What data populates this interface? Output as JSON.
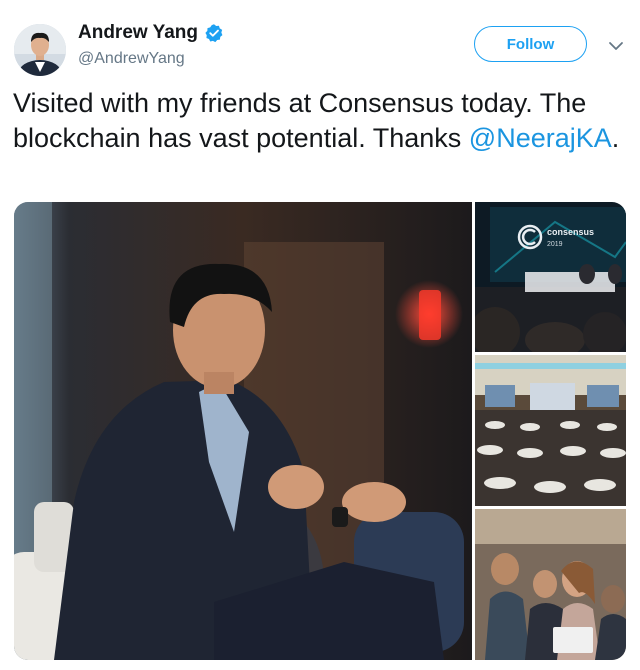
{
  "author": {
    "display_name": "Andrew Yang",
    "handle": "@AndrewYang",
    "verified": true
  },
  "actions": {
    "follow_label": "Follow",
    "more_icon": "chevron-down-icon"
  },
  "tweet": {
    "text_before_mention": "Visited with my friends at Consensus today. The blockchain has vast potential.  Thanks ",
    "mention": "@NeerajKA",
    "text_after_mention": "."
  },
  "media": {
    "photo_count": 4,
    "stage_sign": {
      "brand": "consensus",
      "year": "2019"
    }
  },
  "colors": {
    "accent": "#1da1f2",
    "link": "#1b95e0",
    "text": "#14171a",
    "secondary_text": "#657786"
  }
}
